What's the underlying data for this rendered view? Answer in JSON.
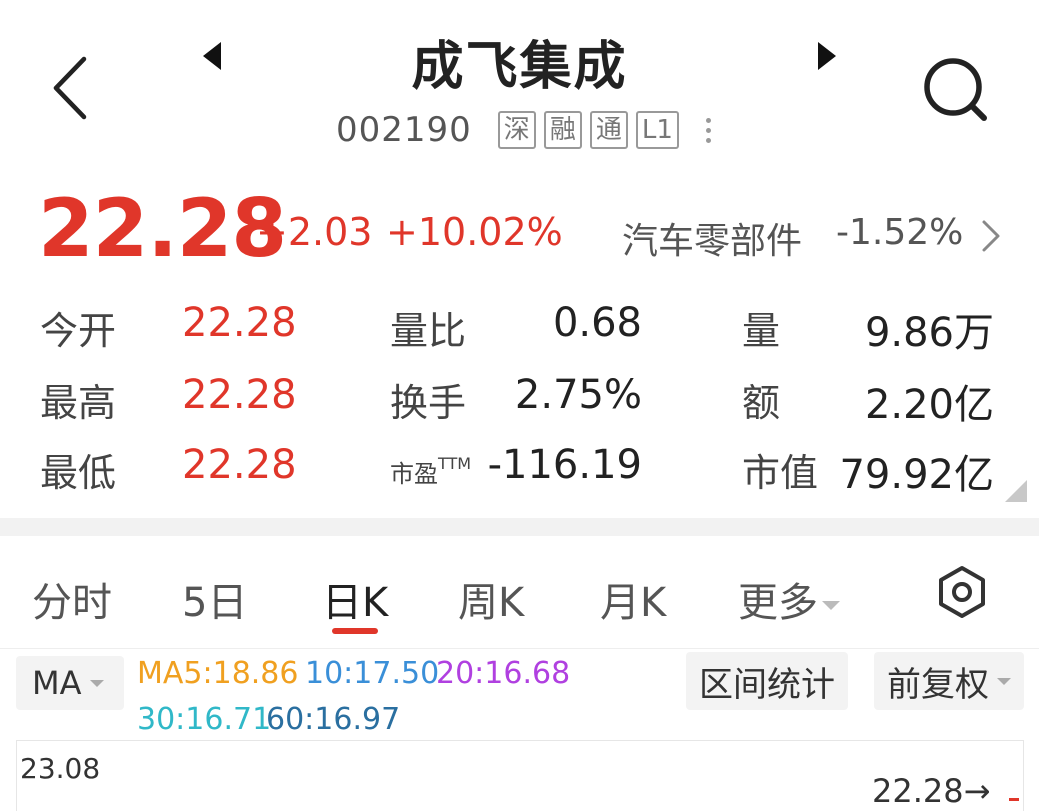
{
  "header": {
    "title": "成飞集成",
    "code": "002190",
    "tags": [
      "深",
      "融",
      "通",
      "L1"
    ]
  },
  "quote": {
    "price": "22.28",
    "change": "+2.03",
    "change_pct": "+10.02%",
    "sector": "汽车零部件",
    "sector_change": "-1.52%"
  },
  "stats": {
    "open_label": "今开",
    "open_value": "22.28",
    "high_label": "最高",
    "high_value": "22.28",
    "low_label": "最低",
    "low_value": "22.28",
    "vol_ratio_label": "量比",
    "vol_ratio_value": "0.68",
    "turnover_label": "换手",
    "turnover_value": "2.75%",
    "pe_label": "市盈",
    "pe_sup": "TTM",
    "pe_value": "-116.19",
    "volume_label": "量",
    "volume_value": "9.86万",
    "amount_label": "额",
    "amount_value": "2.20亿",
    "mktcap_label": "市值",
    "mktcap_value": "79.92亿"
  },
  "tabs": [
    {
      "label": "分时"
    },
    {
      "label": "5日"
    },
    {
      "label": "日K"
    },
    {
      "label": "周K"
    },
    {
      "label": "月K"
    },
    {
      "label": "更多"
    }
  ],
  "indicator": {
    "select": "MA",
    "ma5": "MA5:18.86",
    "ma10": "10:17.50",
    "ma20": "20:16.68",
    "ma30": "30:16.71",
    "ma60": "60:16.97",
    "interval_stats": "区间统计",
    "adjust": "前复权"
  },
  "chart": {
    "axis_top": "23.08",
    "last_price": "22.28→"
  },
  "colors": {
    "up": "#e0362a",
    "ma5": "#f0a020",
    "ma10": "#3a8fd8",
    "ma20": "#b040e0",
    "ma30": "#30b8c8",
    "ma60": "#2a6fa0"
  }
}
